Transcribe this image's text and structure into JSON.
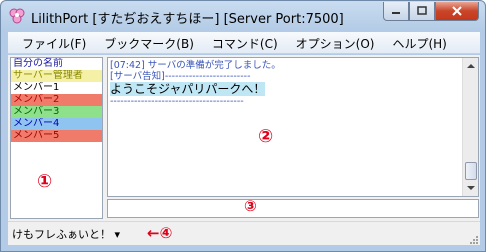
{
  "window": {
    "title": "LilithPort  [すたぢおえすちほー] [Server Port:7500]"
  },
  "menu": [
    {
      "label": "ファイル(F)"
    },
    {
      "label": "ブックマーク(B)"
    },
    {
      "label": "コマンド(C)"
    },
    {
      "label": "オプション(O)"
    },
    {
      "label": "ヘルプ(H)"
    }
  ],
  "users": [
    {
      "name": "自分の名前",
      "color": "#1a1aa6",
      "bg": "#ffffff"
    },
    {
      "name": "サーバー管理者",
      "color": "#8a8a00",
      "bg": "#f4f0a6"
    },
    {
      "name": "メンバー1",
      "color": "#000000",
      "bg": "#ffffff"
    },
    {
      "name": "メンバー2",
      "color": "#b00000",
      "bg": "#f07b6b"
    },
    {
      "name": "メンバー3",
      "color": "#006400",
      "bg": "#8fe08a"
    },
    {
      "name": "メンバー4",
      "color": "#0000b0",
      "bg": "#8fc3f0"
    },
    {
      "name": "メンバー5",
      "color": "#9a0000",
      "bg": "#f07b6b"
    }
  ],
  "log": {
    "line1": "[07:42] サーバの準備が完了しました。",
    "line2": "[サーバ告知]-------------------------",
    "line3": "ようこそジャパリパークへ！",
    "line4": "---------------------------------------"
  },
  "status": {
    "combo_label": "けもフレふぁいと！ ▾"
  },
  "annotations": {
    "a1": "①",
    "a2": "②",
    "a3": "③",
    "a4": "←④"
  },
  "colors": {
    "annotation": "#e0001b",
    "log_text": "#3a55b8",
    "notice_highlight": "#bfe6f5"
  }
}
